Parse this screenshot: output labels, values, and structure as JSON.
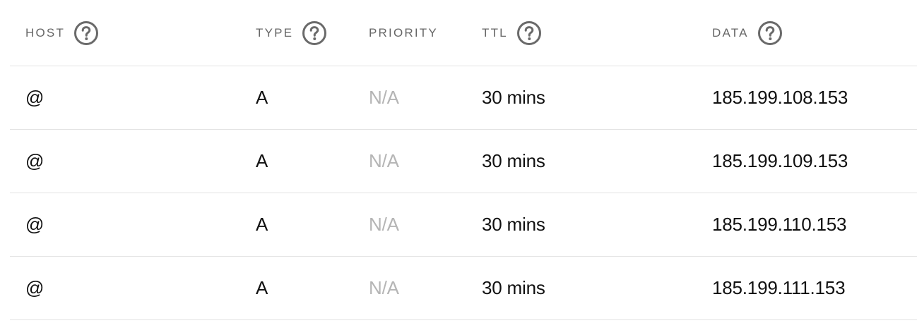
{
  "columns": {
    "host": "HOST",
    "type": "TYPE",
    "priority": "PRIORITY",
    "ttl": "TTL",
    "data": "DATA"
  },
  "help_icon": "question-circle-icon",
  "colors": {
    "header_text": "#666666",
    "muted_text": "#b5b5b5",
    "divider": "#e3e3e3",
    "icon": "#6a6a6a"
  },
  "records": [
    {
      "host": "@",
      "type": "A",
      "priority": "N/A",
      "ttl": "30 mins",
      "data": "185.199.108.153"
    },
    {
      "host": "@",
      "type": "A",
      "priority": "N/A",
      "ttl": "30 mins",
      "data": "185.199.109.153"
    },
    {
      "host": "@",
      "type": "A",
      "priority": "N/A",
      "ttl": "30 mins",
      "data": "185.199.110.153"
    },
    {
      "host": "@",
      "type": "A",
      "priority": "N/A",
      "ttl": "30 mins",
      "data": "185.199.111.153"
    }
  ]
}
